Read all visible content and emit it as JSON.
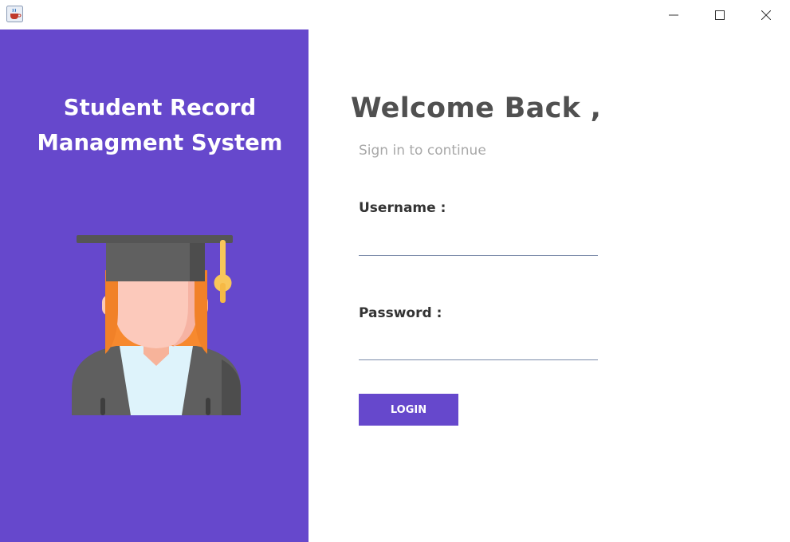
{
  "window": {
    "app_icon": "java-coffee-icon",
    "controls": {
      "minimize": "minimize-icon",
      "maximize": "maximize-icon",
      "close": "close-icon"
    }
  },
  "left_panel": {
    "title_line1": "Student Record",
    "title_line2": "Managment System",
    "illustration": "graduate-avatar-icon",
    "background": "#6648cc"
  },
  "login": {
    "heading": "Welcome Back ,",
    "subheading": "Sign in to continue",
    "username_label": "Username :",
    "username_value": "",
    "password_label": "Password :",
    "password_value": "",
    "button_label": "LOGIN",
    "accent": "#6648cc"
  }
}
